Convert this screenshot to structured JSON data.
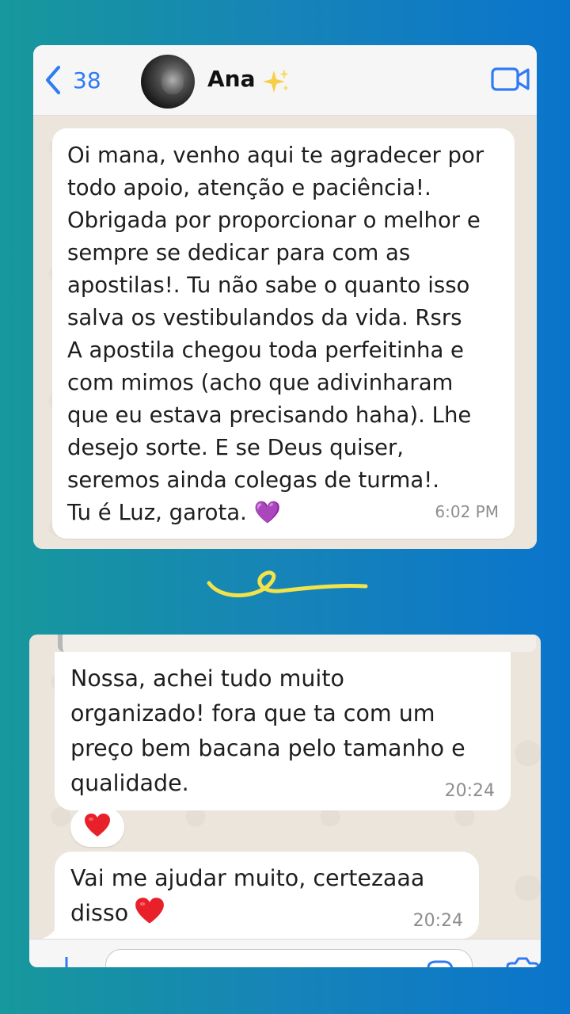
{
  "colors": {
    "accent": "#2f7bf5",
    "bubble": "#ffffff",
    "chat_background": "#ece5dc",
    "squiggle": "#f2e34a",
    "heart": "#e8202a",
    "purple_heart": "#9b3ee6"
  },
  "chat1": {
    "header": {
      "back_icon": "chevron-left-icon",
      "back_count": "38",
      "contact_name": "Ana",
      "name_emoji": "sparkles-icon",
      "video_icon": "video-camera-icon"
    },
    "message": {
      "text": "Oi mana, venho aqui te agradecer por\ntodo apoio, atenção e paciência!.\nObrigada por proporcionar o melhor e\nsempre se dedicar para com as\napostilas!. Tu não sabe o quanto isso\nsalva os vestibulandos da vida. Rsrs\n   A apostila chegou toda perfeitinha e\ncom mimos (acho que adivinharam\nque eu estava precisando haha). Lhe\ndesejo sorte. E se Deus quiser,\nseremos ainda colegas de turma!.\n  Tu é Luz, garota. 💜",
      "time": "6:02 PM"
    }
  },
  "chat2": {
    "messages": [
      {
        "text": "Nossa, achei tudo muito\norganizado! fora que ta com um\npreço bem bacana pelo tamanho e\nqualidade.",
        "time": "20:24",
        "reaction": "red-heart-icon"
      },
      {
        "text": "Vai me ajudar muito, certezaaa\ndisso",
        "emoji": "red-heart-icon",
        "time": "20:24"
      }
    ],
    "input": {
      "plus_icon": "plus-icon",
      "sticker_icon": "sticker-icon",
      "camera_icon": "camera-icon"
    }
  }
}
